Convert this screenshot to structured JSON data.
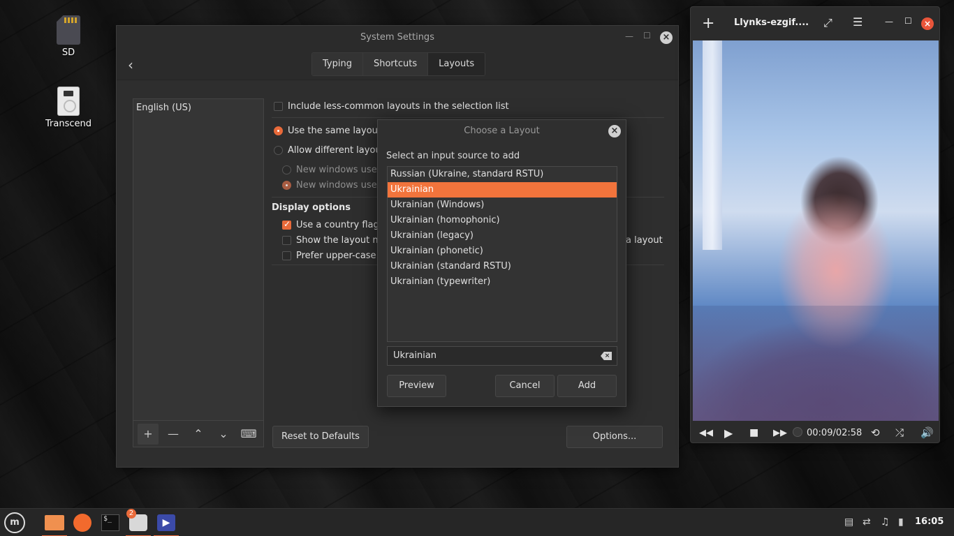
{
  "desktop": {
    "icons": [
      {
        "label": "SD"
      },
      {
        "label": "Transcend"
      }
    ]
  },
  "settings": {
    "title": "System Settings",
    "tabs": [
      "Typing",
      "Shortcuts",
      "Layouts"
    ],
    "active_tab": "Layouts",
    "layouts": [
      "English (US)"
    ],
    "include_less_common": "Include less-common layouts in the selection list",
    "radio_same": "Use the same layout fo",
    "radio_different": "Allow different layout",
    "new_windows_1": "New windows use th",
    "new_windows_2": "New windows use th",
    "display_options": "Display options",
    "use_country_flag": "Use a country flag, i",
    "show_layout_name": "Show the layout nar",
    "show_layout_name_tail": "a layout",
    "prefer_upper": "Prefer upper-case w",
    "reset_button": "Reset to Defaults",
    "options_button": "Options..."
  },
  "dialog": {
    "title": "Choose a Layout",
    "prompt": "Select an input source to add",
    "sources": [
      "Russian (Ukraine, standard RSTU)",
      "Ukrainian",
      "Ukrainian (Windows)",
      "Ukrainian (homophonic)",
      "Ukrainian (legacy)",
      "Ukrainian (phonetic)",
      "Ukrainian (standard RSTU)",
      "Ukrainian (typewriter)"
    ],
    "selected_index": 1,
    "search_value": "Ukrainian",
    "preview_button": "Preview",
    "cancel_button": "Cancel",
    "add_button": "Add"
  },
  "player": {
    "title": "Llynks-ezgif....",
    "time": "00:09/02:58"
  },
  "taskbar": {
    "notification_count": "2",
    "clock": "16:05"
  },
  "colors": {
    "accent": "#e96a3a",
    "selection": "#f2743c",
    "window_bg": "#2e2e2e"
  }
}
